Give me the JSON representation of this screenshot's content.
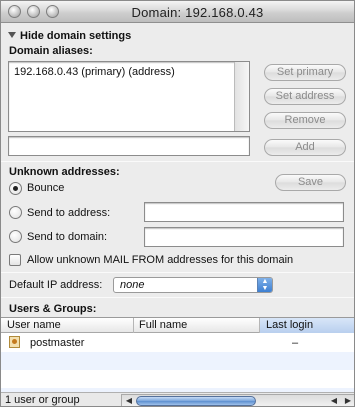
{
  "window": {
    "title": "Domain: 192.168.0.43"
  },
  "settings": {
    "disclosure_label": "Hide domain settings",
    "aliases_label": "Domain aliases:",
    "aliases": [
      "192.168.0.43 (primary) (address)"
    ],
    "alias_input_value": "",
    "buttons": {
      "set_primary": "Set primary",
      "set_address": "Set address",
      "remove": "Remove",
      "add": "Add",
      "save": "Save"
    }
  },
  "unknown": {
    "label": "Unknown addresses:",
    "options": {
      "bounce": "Bounce",
      "send_address": "Send to address:",
      "send_domain": "Send to domain:"
    },
    "selected": "bounce",
    "send_address_value": "",
    "send_domain_value": "",
    "allow_label": "Allow unknown MAIL FROM addresses for this domain",
    "allow_checked": false
  },
  "ip": {
    "label": "Default IP address:",
    "value": "none"
  },
  "users": {
    "label": "Users & Groups:",
    "columns": [
      "User name",
      "Full name",
      "Last login"
    ],
    "sorted_column": "Last login",
    "rows": [
      {
        "user": "postmaster",
        "full_name": "",
        "last_login": "–"
      }
    ],
    "status": "1 user or group"
  },
  "icons": {
    "window_controls": [
      "close-icon",
      "minimize-icon",
      "zoom-icon"
    ],
    "disclosure": "triangle-down-icon",
    "user": "user-icon"
  }
}
